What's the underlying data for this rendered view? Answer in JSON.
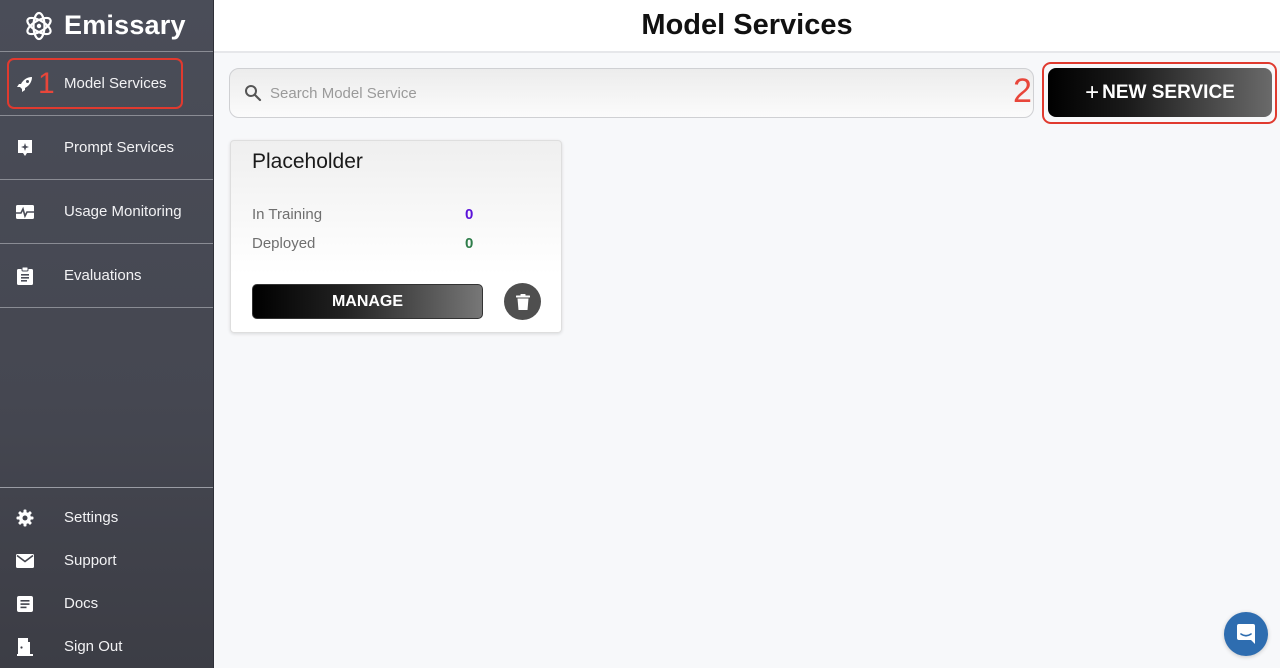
{
  "app": {
    "name": "Emissary",
    "logo_icon": "atom-flower-icon"
  },
  "sidebar": {
    "items": [
      {
        "label": "Model Services",
        "icon": "rocket-icon",
        "active": true,
        "annotation": "1"
      },
      {
        "label": "Prompt Services",
        "icon": "sparkle-badge-icon",
        "active": false
      },
      {
        "label": "Usage Monitoring",
        "icon": "pulse-monitor-icon",
        "active": false
      },
      {
        "label": "Evaluations",
        "icon": "clipboard-icon",
        "active": false
      }
    ],
    "bottom_items": [
      {
        "label": "Settings",
        "icon": "gear-icon"
      },
      {
        "label": "Support",
        "icon": "envelope-icon"
      },
      {
        "label": "Docs",
        "icon": "document-icon"
      },
      {
        "label": "Sign Out",
        "icon": "door-exit-icon"
      }
    ]
  },
  "header": {
    "title": "Model Services"
  },
  "toolbar": {
    "search_placeholder": "Search Model Service",
    "search_value": "",
    "new_service_label": "NEW SERVICE",
    "new_service_plus": "+",
    "annotation": "2"
  },
  "cards": [
    {
      "title": "Placeholder",
      "stats": [
        {
          "label": "In Training",
          "value": "0",
          "color": "#5b12d9"
        },
        {
          "label": "Deployed",
          "value": "0",
          "color": "#2e7d4a"
        }
      ],
      "manage_label": "MANAGE"
    }
  ],
  "colors": {
    "annotation_red": "#e03a2f",
    "chat_blue": "#2e6db0"
  }
}
